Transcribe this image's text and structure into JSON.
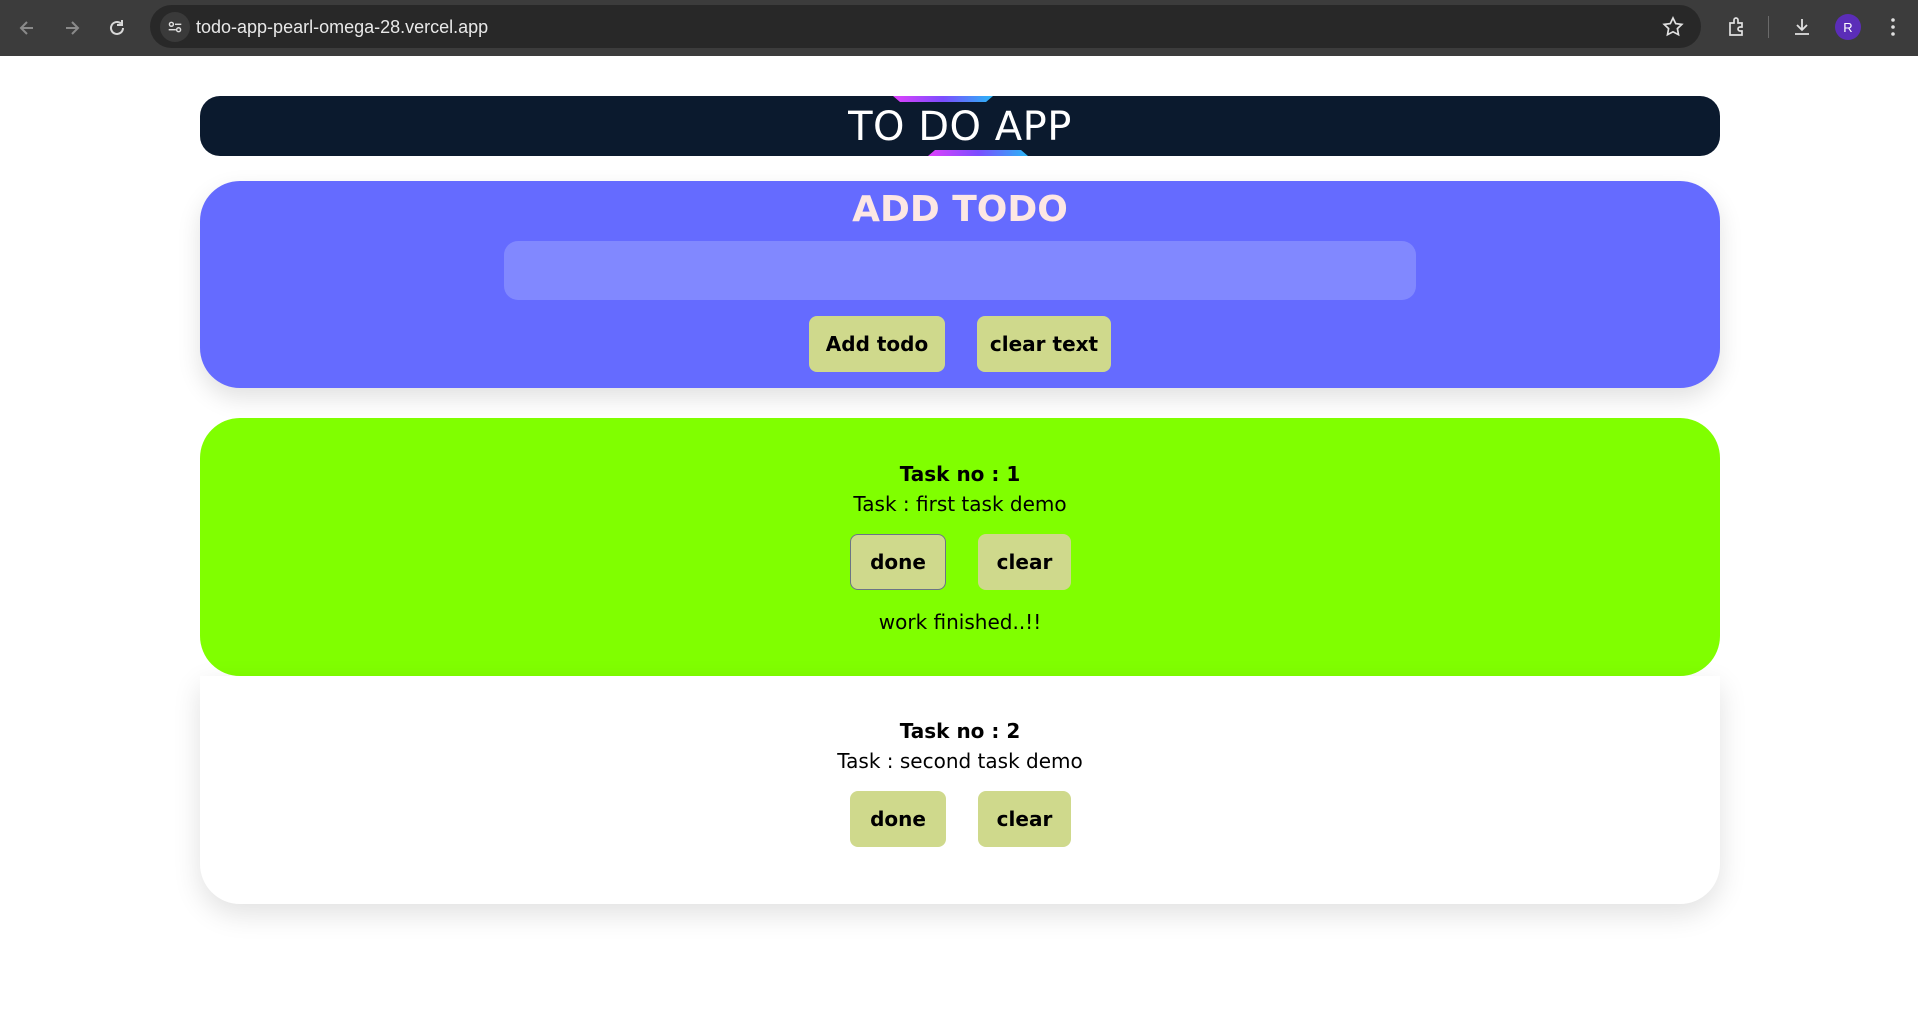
{
  "browser": {
    "url": "todo-app-pearl-omega-28.vercel.app",
    "profile_initial": "R",
    "icons": [
      "back-arrow-icon",
      "forward-arrow-icon",
      "reload-icon",
      "site-info-icon",
      "bookmark-star-icon",
      "extensions-icon",
      "download-icon",
      "menu-dots-icon"
    ]
  },
  "header": {
    "title": "TO DO APP"
  },
  "add_todo": {
    "title": "ADD TODO",
    "input_value": "",
    "input_placeholder": "",
    "add_button": "Add todo",
    "clear_button": "clear text"
  },
  "tasks": [
    {
      "number_label": "Task no : 1",
      "text": "Task : first task demo",
      "done_button": "done",
      "clear_button": "clear",
      "status": "work finished..!!",
      "color": "#80ff00"
    },
    {
      "number_label": "Task no : 2",
      "text": "Task : second task demo",
      "done_button": "done",
      "clear_button": "clear",
      "status": "",
      "color": "#ffffff"
    }
  ],
  "colors": {
    "header_bg": "#0b1a2e",
    "add_card_bg": "#656bff",
    "input_bg": "#8188ff",
    "button_bg": "#cfd98c",
    "done_task_bg": "#80ff00"
  }
}
